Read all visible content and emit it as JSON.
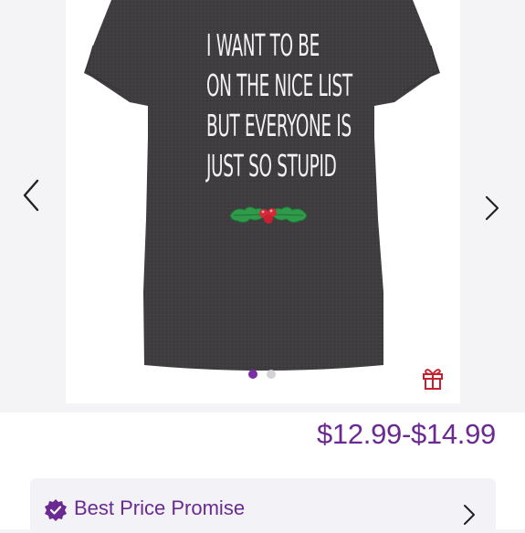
{
  "product": {
    "shirt_text_lines": [
      "I WANT TO BE",
      "ON THE NICE LIST",
      "BUT EVERYONE IS",
      "JUST SO STUPID"
    ],
    "price": "$12.99-$14.99"
  },
  "gallery": {
    "total_images": 2,
    "active_index": 0,
    "icons": {
      "prev": "chevron-left-icon",
      "next": "chevron-right-icon",
      "gift": "gift-icon"
    }
  },
  "promise": {
    "label": "Best Price Promise",
    "icon": "verified-badge-icon"
  },
  "colors": {
    "accent": "#6a2a91",
    "dot_active": "#7a2da6",
    "dot_inactive": "#d3d3d6",
    "shirt": "#3d3b3d",
    "gift": "#c8202f"
  }
}
